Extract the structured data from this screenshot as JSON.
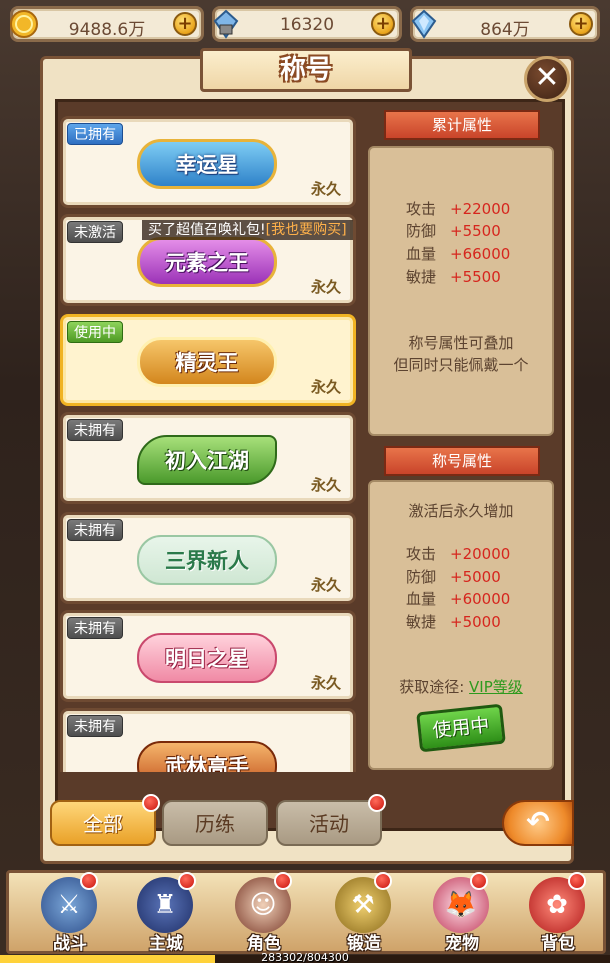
{
  "currency": {
    "gold": "9488.6万",
    "crystal": "16320",
    "diamond": "864万"
  },
  "window": {
    "title": "称号",
    "close": "✕"
  },
  "notice": {
    "text": "买了超值召唤礼包!",
    "link": "[我也要购买]"
  },
  "titles": [
    {
      "tag": "已拥有",
      "name": "幸运星",
      "duration": "永久"
    },
    {
      "tag": "未激活",
      "name": "元素之王",
      "duration": "永久"
    },
    {
      "tag": "使用中",
      "name": "精灵王",
      "duration": "永久"
    },
    {
      "tag": "未拥有",
      "name": "初入江湖",
      "duration": "永久"
    },
    {
      "tag": "未拥有",
      "name": "三界新人",
      "duration": "永久"
    },
    {
      "tag": "未拥有",
      "name": "明日之星",
      "duration": "永久"
    },
    {
      "tag": "未拥有",
      "name": "武林高手",
      "duration": ""
    }
  ],
  "cumulative": {
    "header": "累计属性",
    "stats": [
      {
        "label": "攻击",
        "value": "+22000"
      },
      {
        "label": "防御",
        "value": "+5500"
      },
      {
        "label": "血量",
        "value": "+66000"
      },
      {
        "label": "敏捷",
        "value": "+5500"
      }
    ],
    "note1": "称号属性可叠加",
    "note2": "但同时只能佩戴一个"
  },
  "title_attr": {
    "header": "称号属性",
    "intro": "激活后永久增加",
    "stats": [
      {
        "label": "攻击",
        "value": "+20000"
      },
      {
        "label": "防御",
        "value": "+5000"
      },
      {
        "label": "血量",
        "value": "+60000"
      },
      {
        "label": "敏捷",
        "value": "+5000"
      }
    ],
    "source_label": "获取途径:",
    "source_value": "VIP等级",
    "button": "使用中"
  },
  "tabs": [
    "全部",
    "历练",
    "活动"
  ],
  "back": "↶",
  "nav": [
    "战斗",
    "主城",
    "角色",
    "锻造",
    "宠物",
    "背包"
  ],
  "exp": {
    "text": "283302/804300",
    "fraction": 0.352
  },
  "colors": {
    "stat_value": "#d6261e",
    "vip": "#2e9a1e",
    "active_border": "#f0b323"
  }
}
